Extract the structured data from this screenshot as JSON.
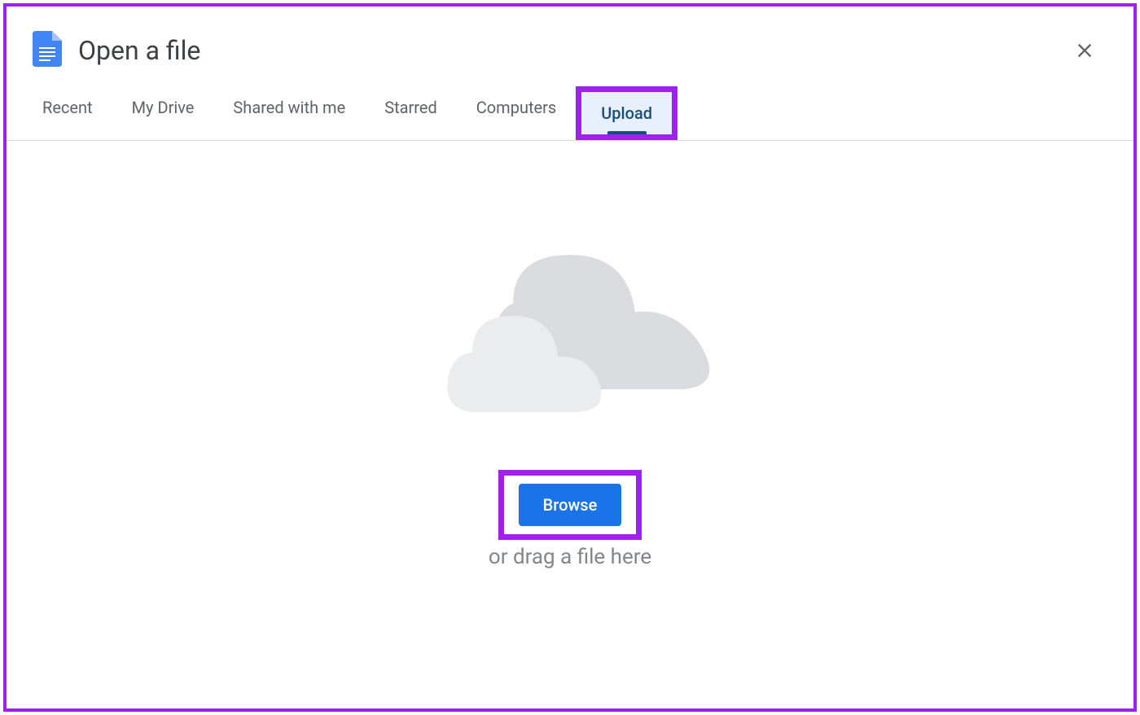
{
  "dialog": {
    "title": "Open a file"
  },
  "tabs": {
    "items": [
      {
        "label": "Recent",
        "active": false
      },
      {
        "label": "My Drive",
        "active": false
      },
      {
        "label": "Shared with me",
        "active": false
      },
      {
        "label": "Starred",
        "active": false
      },
      {
        "label": "Computers",
        "active": false
      },
      {
        "label": "Upload",
        "active": true
      }
    ]
  },
  "upload": {
    "browse_label": "Browse",
    "drag_text": "or drag a file here"
  }
}
